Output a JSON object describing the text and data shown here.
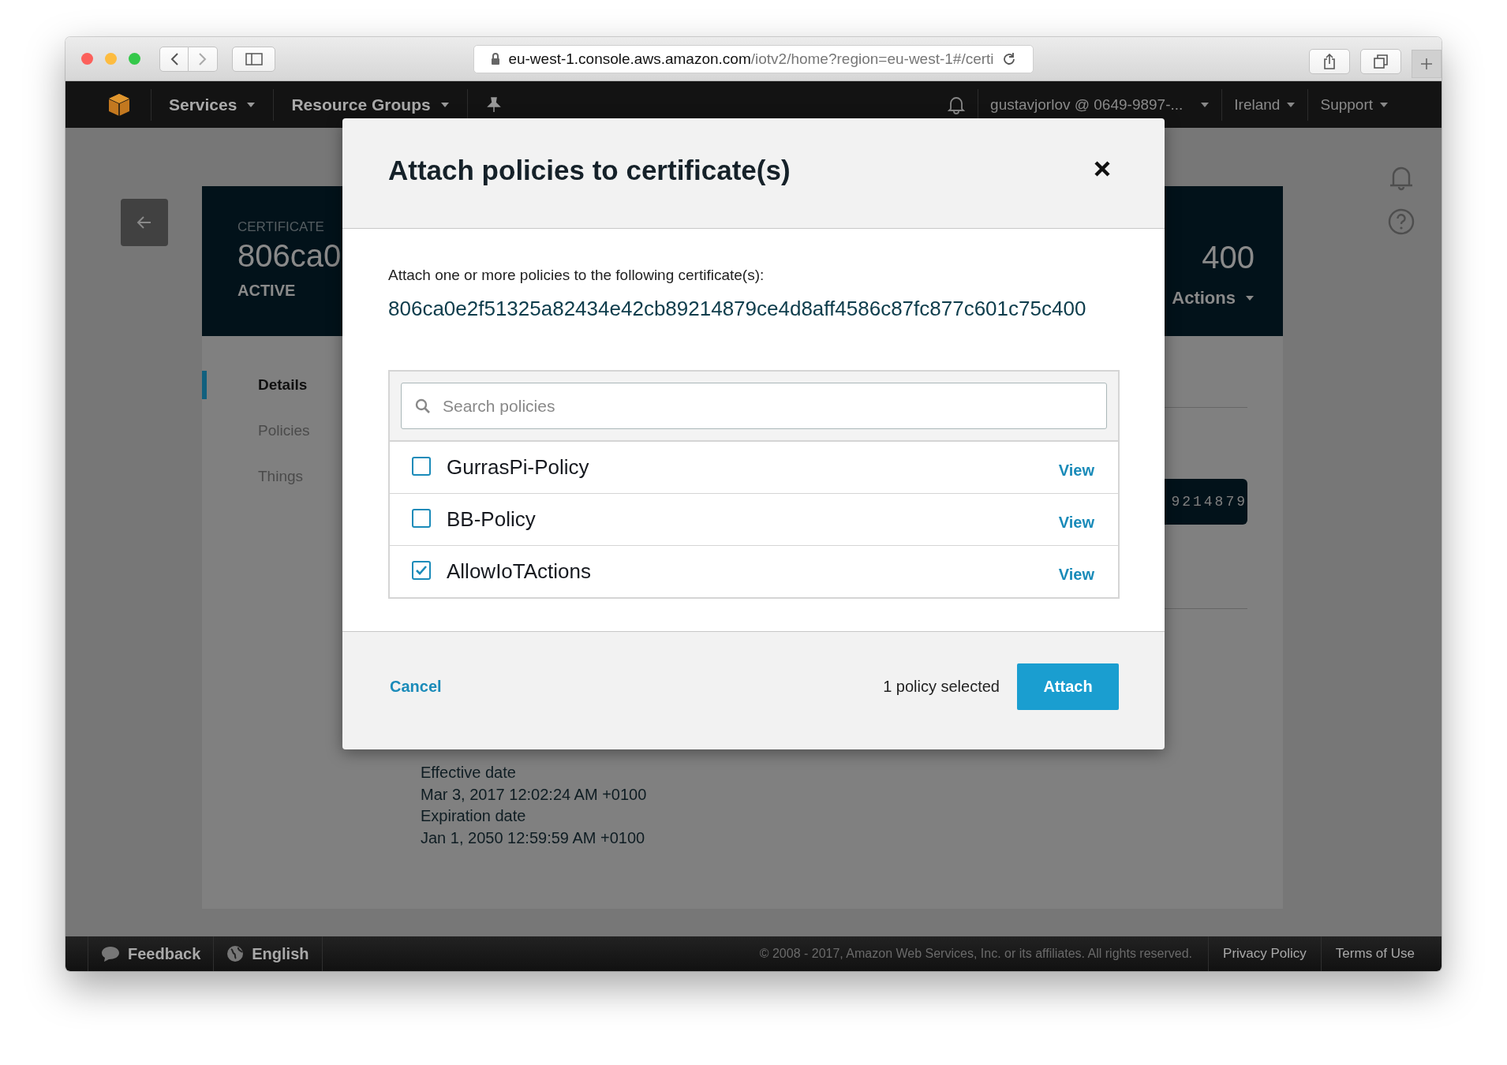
{
  "browser": {
    "url_host": "eu-west-1.console.aws.amazon.com",
    "url_path": "/iotv2/home?region=eu-west-1#/certi"
  },
  "navbar": {
    "menus": [
      {
        "label": "Services"
      },
      {
        "label": "Resource Groups"
      }
    ],
    "account": "gustavjorlov @ 0649-9897-...",
    "region": "Ireland",
    "support": "Support"
  },
  "certificate": {
    "eyebrow": "CERTIFICATE",
    "title_start": "806ca0",
    "title_end": "400",
    "status": "ACTIVE",
    "actions": "Actions",
    "tabs": [
      {
        "label": "Details",
        "selected": true
      },
      {
        "label": "Policies",
        "selected": false
      },
      {
        "label": "Things",
        "selected": false
      }
    ],
    "code_fragment": "9214879",
    "details": [
      {
        "label": "Effective date",
        "value": "Mar 3, 2017 12:02:24 AM +0100"
      },
      {
        "label": "Expiration date",
        "value": "Jan 1, 2050 12:59:59 AM +0100"
      }
    ]
  },
  "modal": {
    "title": "Attach policies to certificate(s)",
    "intro": "Attach one or more policies to the following certificate(s):",
    "certificate_id": "806ca0e2f51325a82434e42cb89214879ce4d8aff4586c87fc877c601c75c400",
    "search": {
      "placeholder": "Search policies"
    },
    "policies": [
      {
        "name": "GurrasPi-Policy",
        "checked": false,
        "action": "View"
      },
      {
        "name": "BB-Policy",
        "checked": false,
        "action": "View"
      },
      {
        "name": "AllowIoTActions",
        "checked": true,
        "action": "View"
      }
    ],
    "cancel": "Cancel",
    "selection_count": "1 policy selected",
    "submit": "Attach"
  },
  "footer": {
    "feedback": "Feedback",
    "language": "English",
    "copyright": "© 2008 - 2017, Amazon Web Services, Inc. or its affiliates. All rights reserved.",
    "links": [
      "Privacy Policy",
      "Terms of Use"
    ]
  }
}
